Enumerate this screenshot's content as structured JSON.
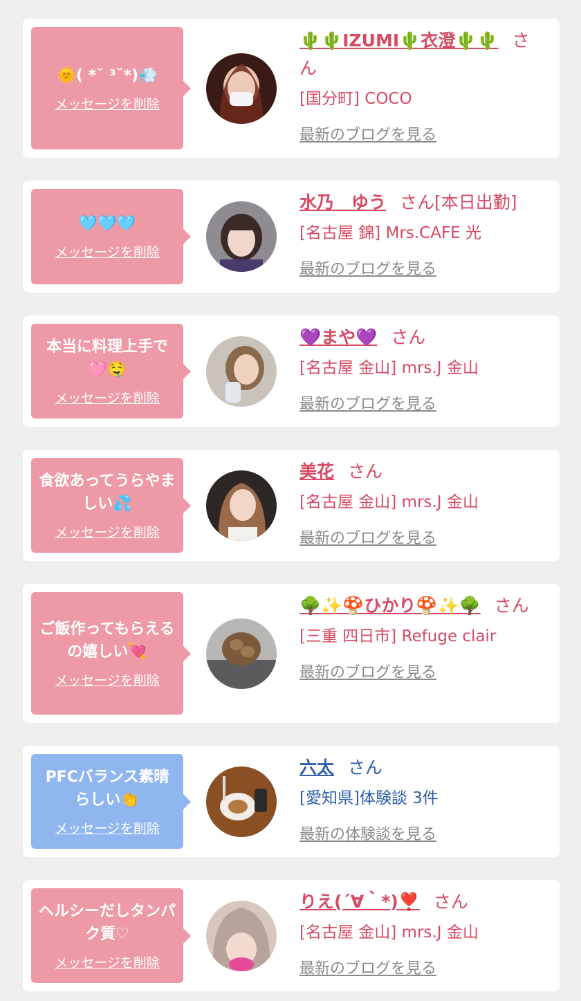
{
  "messages": [
    {
      "bubble_text": "🌞( *˘ ³˘*)💨",
      "delete_label": "メッセージを削除",
      "bubble_color": "#ed9aa6",
      "name": "🌵🌵IZUMI🌵衣澄🌵🌵",
      "honorific": "さん",
      "shop": "[国分町] COCO",
      "blog_link": "最新のブログを見る",
      "avatar_icon": "woman-in-mask-photo",
      "link_color": "#d64a63"
    },
    {
      "bubble_text": "🩵🩵🩵",
      "delete_label": "メッセージを削除",
      "bubble_color": "#ed9aa6",
      "name": "水乃　ゆう",
      "honorific": "さん[本日出勤]",
      "shop": "[名古屋 錦] Mrs.CAFE 光",
      "blog_link": "最新のブログを見る",
      "avatar_icon": "woman-with-bangs-photo",
      "link_color": "#d64a63"
    },
    {
      "bubble_text": "本当に料理上手で🩷🤤",
      "delete_label": "メッセージを削除",
      "bubble_color": "#ed9aa6",
      "name": "💜まや💜",
      "honorific": "さん",
      "shop": "[名古屋 金山] mrs.J 金山",
      "blog_link": "最新のブログを見る",
      "avatar_icon": "woman-holding-drink-photo",
      "link_color": "#d64a63"
    },
    {
      "bubble_text": "食欲あってうらやましい💦",
      "delete_label": "メッセージを削除",
      "bubble_color": "#ed9aa6",
      "name": "美花",
      "honorific": "さん",
      "shop": "[名古屋 金山] mrs.J 金山",
      "blog_link": "最新のブログを見る",
      "avatar_icon": "woman-long-hair-photo",
      "link_color": "#d64a63"
    },
    {
      "bubble_text": "ご飯作ってもらえるの嬉しい💘",
      "delete_label": "メッセージを削除",
      "bubble_color": "#ed9aa6",
      "name": "🌳✨🍄ひかり🍄✨🌳",
      "honorific": "さん",
      "shop": "[三重 四日市] Refuge clair",
      "blog_link": "最新のブログを見る",
      "avatar_icon": "hair-back-photo",
      "link_color": "#d64a63"
    },
    {
      "bubble_text": "PFCバランス素晴らしい👏",
      "delete_label": "メッセージを削除",
      "bubble_color": "#8fb6ef",
      "name": "六太",
      "honorific": "さん",
      "shop": "[愛知県]体験談 3件",
      "blog_link": "最新の体験談を見る",
      "avatar_icon": "food-plate-photo",
      "link_color": "#2d5fa8"
    },
    {
      "bubble_text": "ヘルシーだしタンパク質♡",
      "delete_label": "メッセージを削除",
      "bubble_color": "#ed9aa6",
      "name": "りえ(´∀｀*)❣️",
      "honorific": "さん",
      "shop": "[名古屋 金山] mrs.J 金山",
      "blog_link": "最新のブログを見る",
      "avatar_icon": "blonde-hair-photo",
      "link_color": "#d64a63"
    }
  ]
}
